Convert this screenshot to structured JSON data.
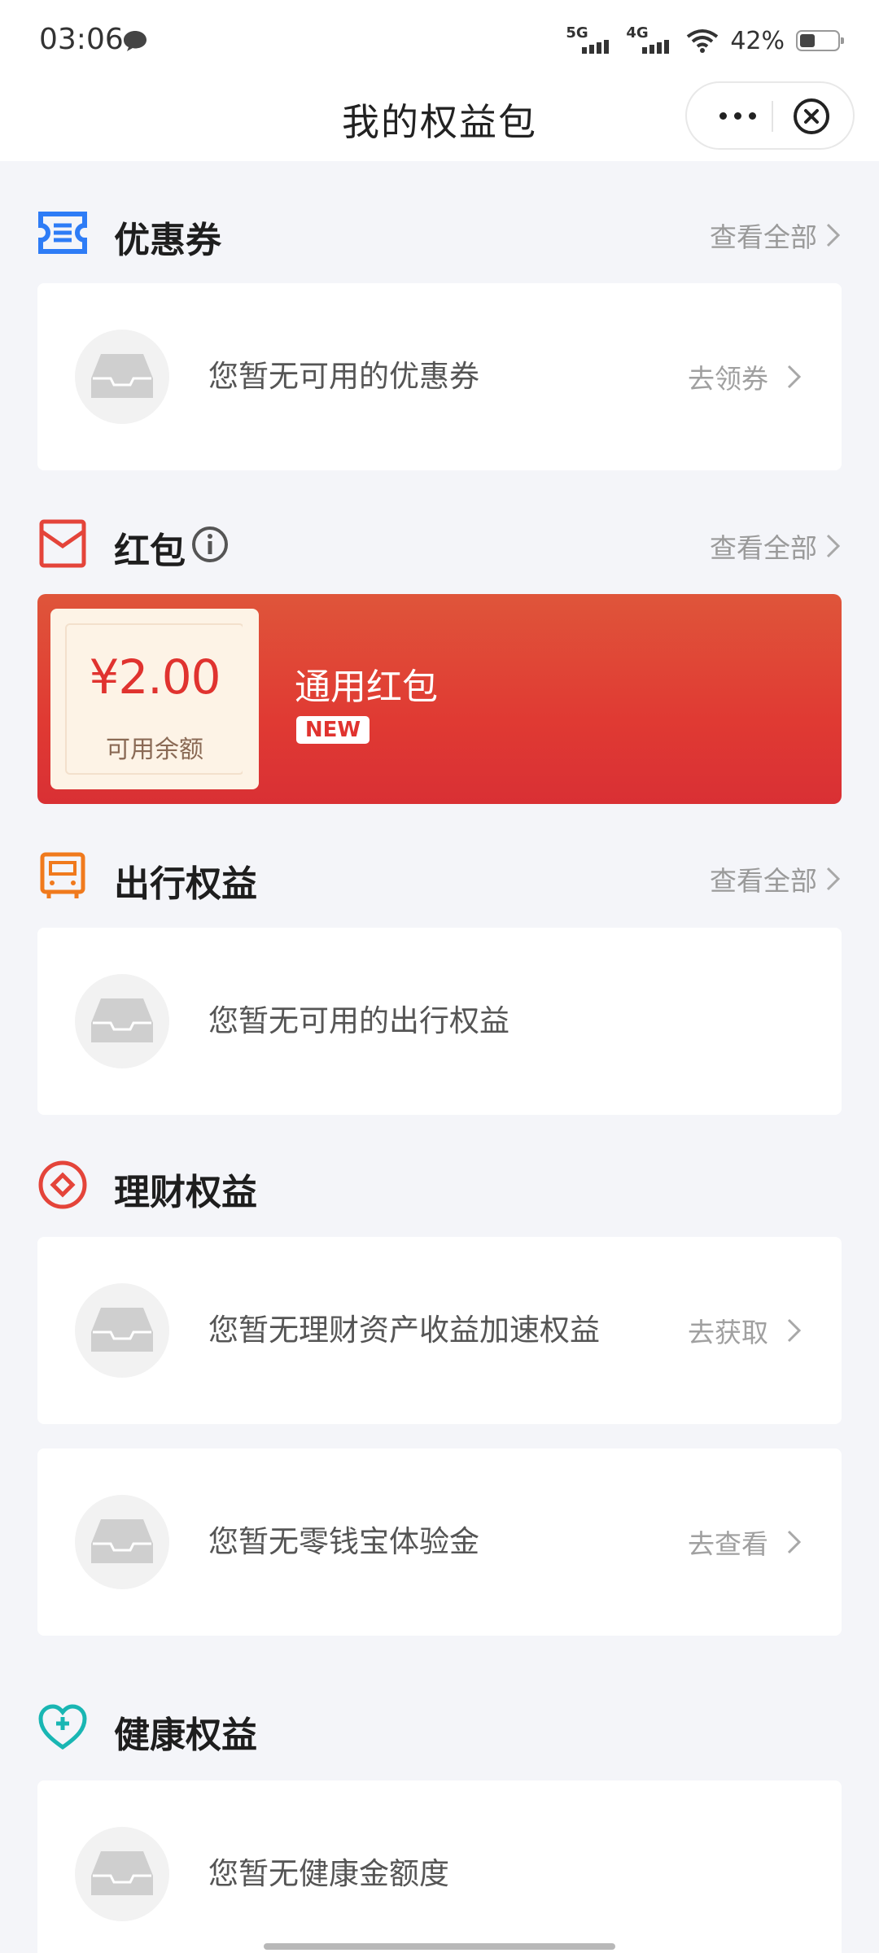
{
  "status_bar": {
    "time": "03:06",
    "network_1": "5G",
    "network_2": "4G",
    "battery": "42%"
  },
  "header": {
    "title": "我的权益包"
  },
  "coupons": {
    "title": "优惠券",
    "more": "查看全部",
    "empty_text": "您暂无可用的优惠券",
    "action": "去领券",
    "icon_color": "#2e7cf6"
  },
  "red_packet": {
    "title": "红包",
    "more": "查看全部",
    "amount": "¥2.00",
    "amount_label": "可用余额",
    "name": "通用红包",
    "badge": "NEW",
    "icon_color": "#e4443a"
  },
  "travel": {
    "title": "出行权益",
    "more": "查看全部",
    "empty_text": "您暂无可用的出行权益",
    "icon_color": "#f07a1d"
  },
  "wealth": {
    "title": "理财权益",
    "icon_color": "#e4443a",
    "cards": [
      {
        "text": "您暂无理财资产收益加速权益",
        "action": "去获取"
      },
      {
        "text": "您暂无零钱宝体验金",
        "action": "去查看"
      }
    ]
  },
  "health": {
    "title": "健康权益",
    "empty_text": "您暂无健康金额度",
    "icon_color": "#19b6b3"
  }
}
